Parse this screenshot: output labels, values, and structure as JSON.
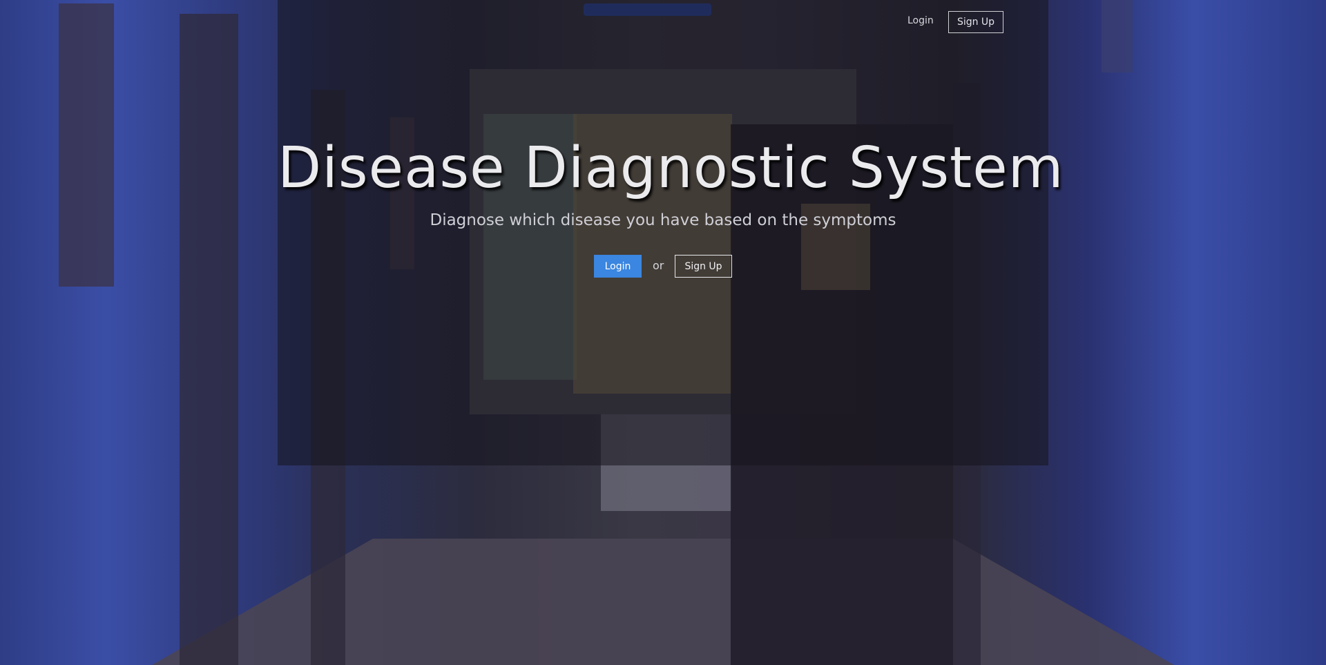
{
  "nav": {
    "login_label": "Login",
    "signup_label": "Sign Up"
  },
  "hero": {
    "title": "Disease Diagnostic System",
    "subtitle": "Diagnose which disease you have based on the symptoms",
    "login_label": "Login",
    "or_text": "or",
    "signup_label": "Sign Up"
  },
  "colors": {
    "accent": "#3a86e0",
    "panel_overlay": "#16141e"
  }
}
